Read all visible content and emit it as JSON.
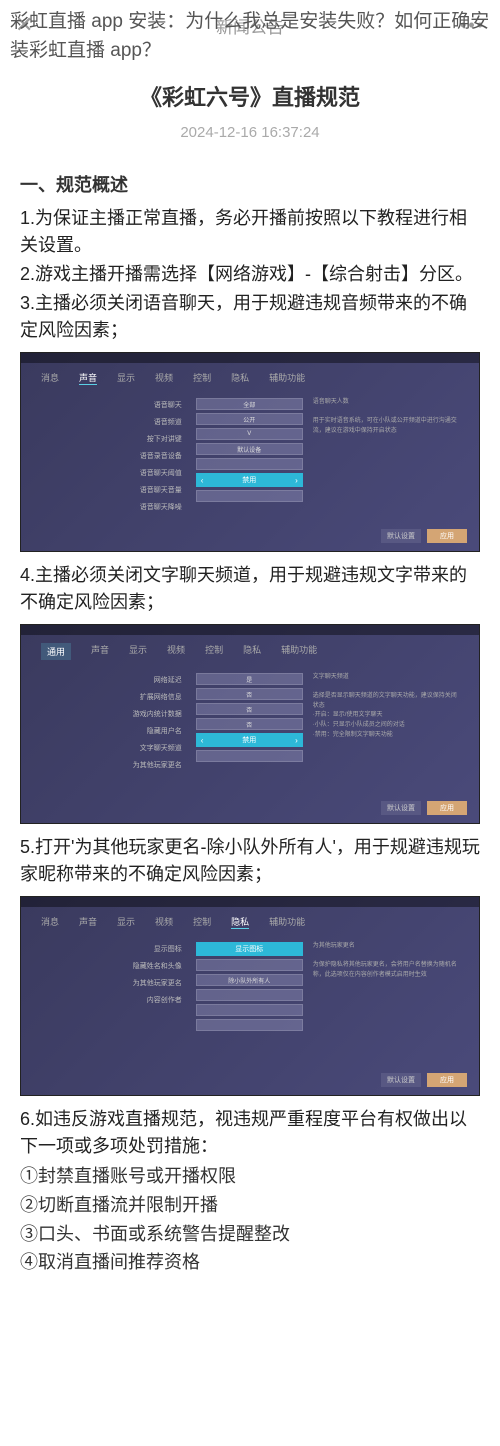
{
  "overlay": {
    "title": "彩虹直播 app 安装：为什么我总是安装失败？如何正确安装彩虹直播 app？"
  },
  "header": {
    "label": "新闻公告"
  },
  "article": {
    "title": "《彩虹六号》直播规范",
    "date": "2024-12-16 16:37:24"
  },
  "section1": {
    "heading": "一、规范概述",
    "p1": "1.为保证主播正常直播，务必开播前按照以下教程进行相关设置。",
    "p2": "2.游戏主播开播需选择【网络游戏】-【综合射击】分区。",
    "p3": "3.主播必须关闭语音聊天，用于规避违规音频带来的不确定风险因素；",
    "p4": "4.主播必须关闭文字聊天频道，用于规避违规文字带来的不确定风险因素；",
    "p5": "5.打开'为其他玩家更名-除小队外所有人'，用于规避违规玩家昵称带来的不确定风险因素；",
    "p6": "6.如违反游戏直播规范，视违规严重程度平台有权做出以下一项或多项处罚措施：",
    "penalty1": "①封禁直播账号或开播权限",
    "penalty2": "②切断直播流并限制开播",
    "penalty3": "③口头、书面或系统警告提醒整改",
    "penalty4": "④取消直播间推荐资格"
  },
  "game_tabs": {
    "t1": "消息",
    "t2": "声音",
    "t3": "显示",
    "t4": "视频",
    "t5": "控制",
    "t6": "隐私",
    "t7": "辅助功能",
    "general": "通用"
  },
  "game_opts": {
    "l1": "语音聊天",
    "l2": "语音频道",
    "l3": "按下对讲键",
    "l4": "语音录音设备",
    "l5": "语音聊天阈值",
    "l6": "语音聊天音量",
    "l7": "语音聊天降噪",
    "v1": "全部",
    "v2": "公开",
    "v3": "V",
    "v4": "默认设备",
    "highlight": "禁用",
    "btn_default": "默认设置",
    "btn_apply": "应用"
  },
  "game_opts2": {
    "l1": "网络延迟",
    "l2": "扩展网络信息",
    "l3": "游戏内统计数据",
    "l4": "隐藏用户名",
    "l5": "文字聊天频道",
    "l6": "为其他玩家更名",
    "v1": "是",
    "v2": "否",
    "v3": "否",
    "v4": "否",
    "highlight": "禁用"
  },
  "game_opts3": {
    "l1": "显示图标",
    "l2": "隐藏姓名和头像",
    "l3": "为其他玩家更名",
    "l4": "内容创作者",
    "highlight_top": "显示图标",
    "v3": "除小队外所有人"
  }
}
